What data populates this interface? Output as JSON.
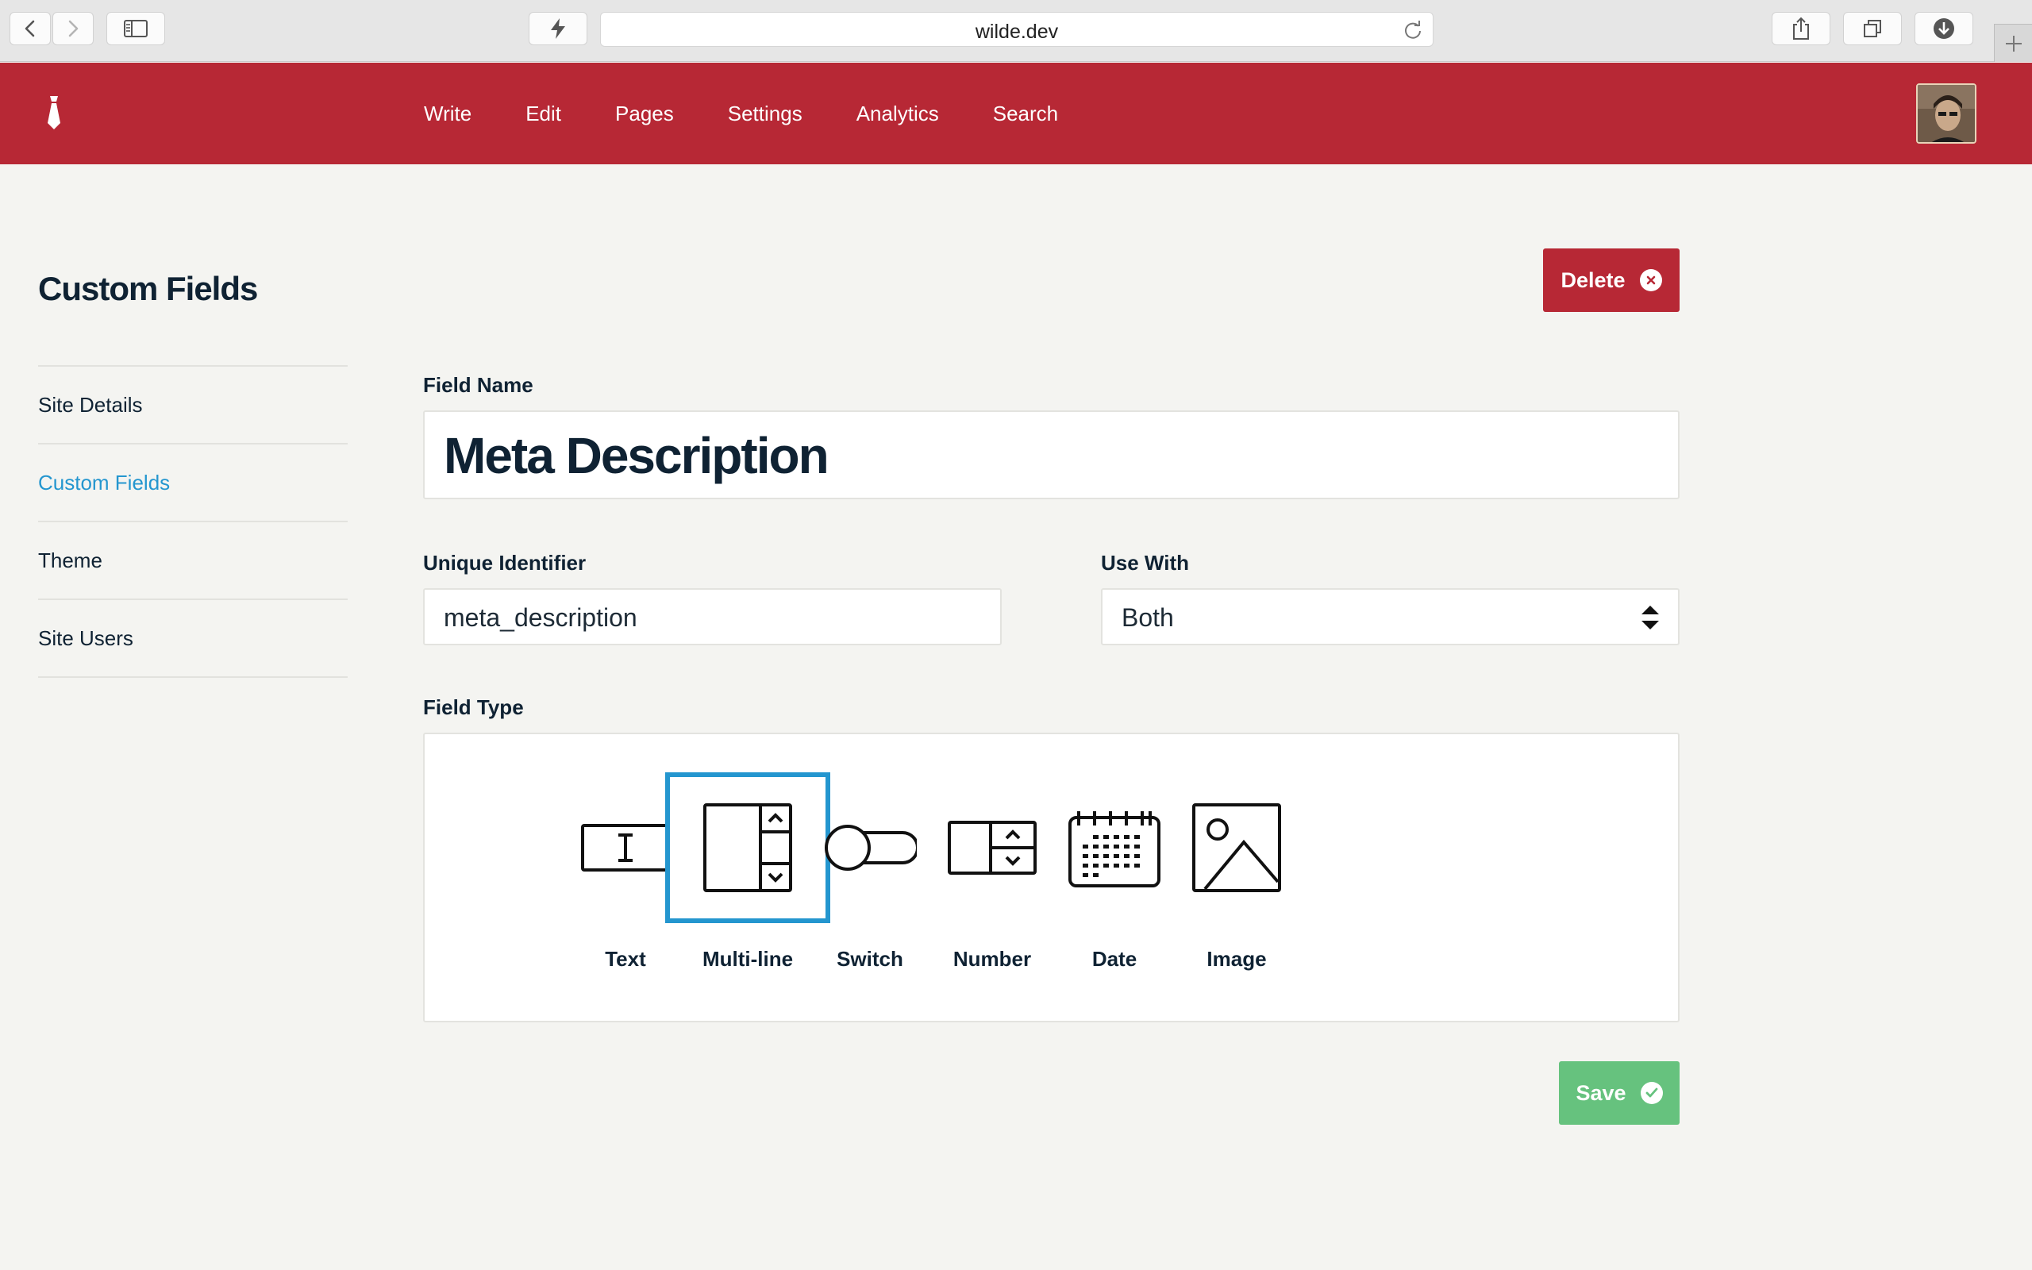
{
  "browser": {
    "url": "wilde.dev",
    "icons": [
      "back-icon",
      "forward-icon",
      "sidebar-icon",
      "lightning-icon",
      "reload-icon",
      "share-icon",
      "tabs-icon",
      "download-icon",
      "new-tab-icon"
    ]
  },
  "header": {
    "logo": "tie-logo",
    "nav": [
      "Write",
      "Edit",
      "Pages",
      "Settings",
      "Analytics",
      "Search"
    ],
    "accent_color": "#b72835"
  },
  "sidebar": {
    "title": "Custom Fields",
    "items": [
      {
        "label": "Site Details",
        "active": false
      },
      {
        "label": "Custom Fields",
        "active": true
      },
      {
        "label": "Theme",
        "active": false
      },
      {
        "label": "Site Users",
        "active": false
      }
    ],
    "active_color": "#2496cf"
  },
  "form": {
    "delete_label": "Delete",
    "save_label": "Save",
    "field_name_label": "Field Name",
    "field_name_value": "Meta Description",
    "identifier_label": "Unique Identifier",
    "identifier_value": "meta_description",
    "use_with_label": "Use With",
    "use_with_value": "Both",
    "field_type_label": "Field Type",
    "field_types": [
      {
        "label": "Text",
        "icon": "text-field-icon",
        "selected": false
      },
      {
        "label": "Multi-line",
        "icon": "multiline-icon",
        "selected": true
      },
      {
        "label": "Switch",
        "icon": "switch-icon",
        "selected": false
      },
      {
        "label": "Number",
        "icon": "number-stepper-icon",
        "selected": false
      },
      {
        "label": "Date",
        "icon": "calendar-icon",
        "selected": false
      },
      {
        "label": "Image",
        "icon": "image-icon",
        "selected": false
      }
    ],
    "delete_color": "#b72835",
    "save_color": "#66c27e"
  }
}
